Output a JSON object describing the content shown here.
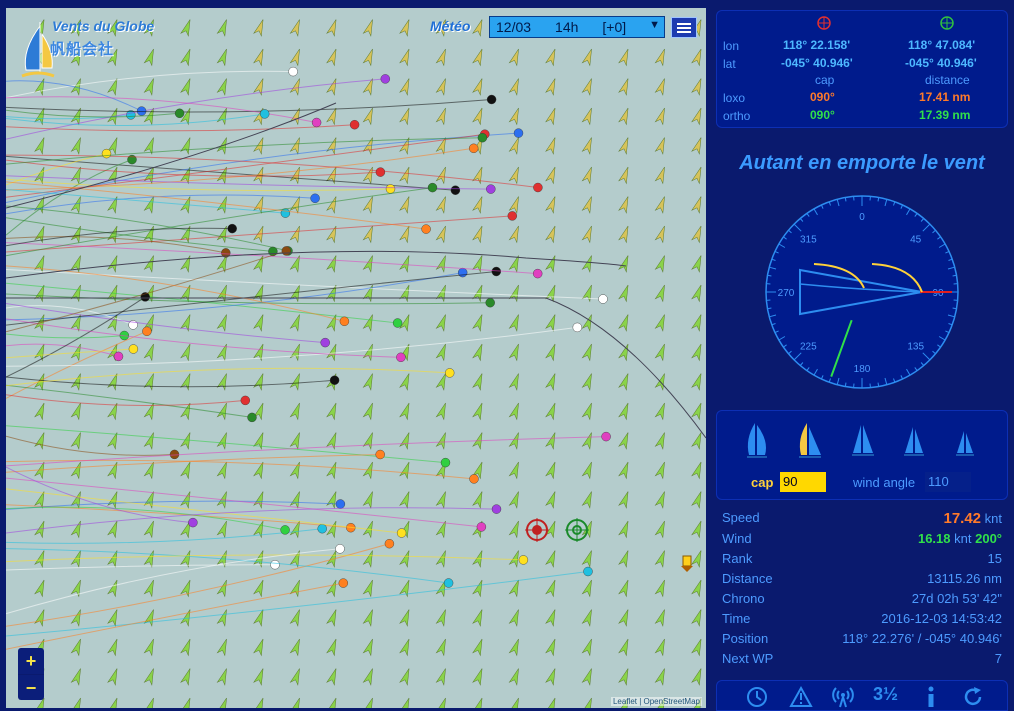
{
  "app": {
    "logo_title": "Vents du Globe",
    "logo_subtitle": "帆船会社"
  },
  "meteo": {
    "label": "Météo",
    "date": "12/03",
    "hour": "14h",
    "offset": "[+0]"
  },
  "map": {
    "zoom_in": "+",
    "zoom_out": "−",
    "attribution": "Leaflet | OpenStreetMap"
  },
  "nav": {
    "lon_label": "lon",
    "lat_label": "lat",
    "lon_1": "118° 22.158'",
    "lat_1": "-045° 40.946'",
    "lon_2": "118° 47.084'",
    "lat_2": "-045° 40.946'",
    "cap_header": "cap",
    "distance_header": "distance",
    "loxo_label": "loxo",
    "ortho_label": "ortho",
    "loxo_cap": "090°",
    "loxo_distance": "17.41 nm",
    "ortho_cap": "090°",
    "ortho_distance": "17.39 nm"
  },
  "boat_name": "Autant en emporte le vent",
  "compass": {
    "labels": [
      "0",
      "45",
      "90",
      "135",
      "180",
      "225",
      "270",
      "315"
    ],
    "heading": 90,
    "wind_direction": 200
  },
  "controls": {
    "cap_label": "cap",
    "cap_value": "90",
    "wind_angle_label": "wind angle",
    "wind_angle_value": "110"
  },
  "status": {
    "speed_label": "Speed",
    "speed_value": "17.42",
    "speed_unit": "knt",
    "wind_label": "Wind",
    "wind_speed": "16.18",
    "wind_unit": "knt",
    "wind_dir": "200°",
    "rank_label": "Rank",
    "rank_value": "15",
    "distance_label": "Distance",
    "distance_value": "13115.26 nm",
    "chrono_label": "Chrono",
    "chrono_value": "27d 02h 53' 42\"",
    "time_label": "Time",
    "time_value": "2016-12-03 14:53:42",
    "position_label": "Position",
    "position_value": "118° 22.276' / -045° 40.946'",
    "nextwp_label": "Next WP",
    "nextwp_value": "7"
  },
  "toolbar": {
    "ranking_icon": "3½"
  },
  "colors": {
    "background": "#0a1a6e",
    "map": "#b4cccc",
    "accent": "#4d9bff",
    "orange": "#ff7a2a",
    "green": "#30e04a",
    "yellow": "#ffd800"
  }
}
